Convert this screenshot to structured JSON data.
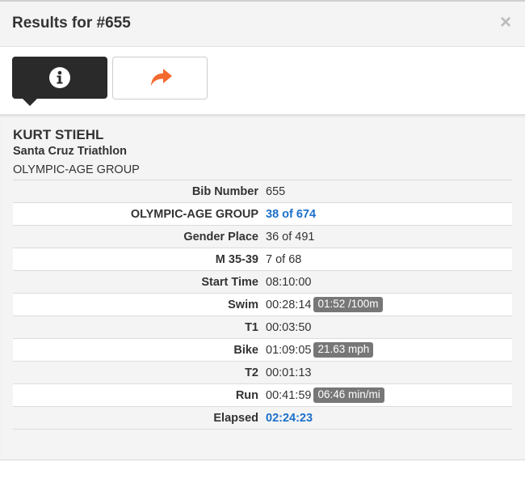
{
  "modal": {
    "title": "Results for #655",
    "close_label": "×"
  },
  "tabs": [
    {
      "icon": "info-icon",
      "active": true
    },
    {
      "icon": "share-icon",
      "active": false
    }
  ],
  "colors": {
    "active_tab": "#2a2a2a",
    "share_icon": "#f26a2e",
    "link": "#1a6fc9",
    "badge": "#777777"
  },
  "athlete": {
    "name": "KURT STIEHL",
    "race": "Santa Cruz Triathlon",
    "division": "OLYMPIC-AGE GROUP"
  },
  "results": [
    {
      "label": "Bib Number",
      "value": "655",
      "link": false,
      "badge": ""
    },
    {
      "label": "OLYMPIC-AGE GROUP",
      "value": "38 of 674",
      "link": true,
      "badge": ""
    },
    {
      "label": "Gender Place",
      "value": "36 of 491",
      "link": false,
      "badge": ""
    },
    {
      "label": "M 35-39",
      "value": "7 of 68",
      "link": false,
      "badge": ""
    },
    {
      "label": "Start Time",
      "value": "08:10:00",
      "link": false,
      "badge": ""
    },
    {
      "label": "Swim",
      "value": "00:28:14",
      "link": false,
      "badge": "01:52 /100m"
    },
    {
      "label": "T1",
      "value": "00:03:50",
      "link": false,
      "badge": ""
    },
    {
      "label": "Bike",
      "value": "01:09:05",
      "link": false,
      "badge": "21.63 mph"
    },
    {
      "label": "T2",
      "value": "00:01:13",
      "link": false,
      "badge": ""
    },
    {
      "label": "Run",
      "value": "00:41:59",
      "link": false,
      "badge": "06:46 min/mi"
    },
    {
      "label": "Elapsed",
      "value": "02:24:23",
      "link": true,
      "badge": ""
    }
  ]
}
